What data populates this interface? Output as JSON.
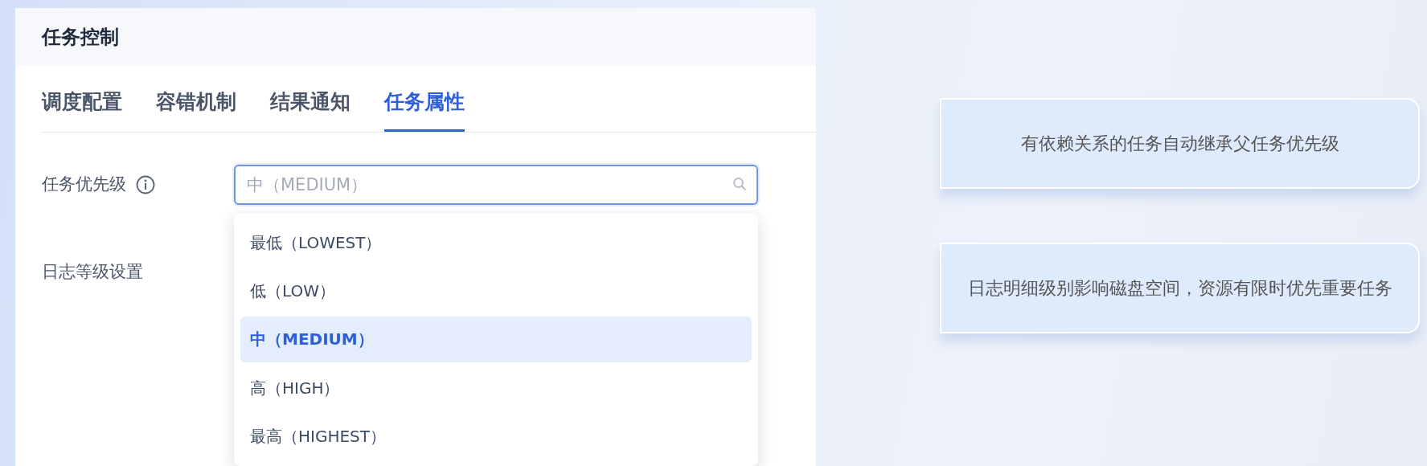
{
  "panel": {
    "title": "任务控制"
  },
  "tabs": [
    {
      "label": "调度配置",
      "selected": false
    },
    {
      "label": "容错机制",
      "selected": false
    },
    {
      "label": "结果通知",
      "selected": false
    },
    {
      "label": "任务属性",
      "selected": true
    }
  ],
  "fields": [
    {
      "label": "任务优先级",
      "info": true,
      "select": {
        "placeholder": "中（MEDIUM）",
        "open": true,
        "options": [
          {
            "label": "最低（LOWEST）",
            "selected": false
          },
          {
            "label": "低（LOW）",
            "selected": false
          },
          {
            "label": "中（MEDIUM）",
            "selected": true
          },
          {
            "label": "高（HIGH）",
            "selected": false
          },
          {
            "label": "最高（HIGHEST）",
            "selected": false
          }
        ]
      }
    },
    {
      "label": "日志等级设置"
    }
  ],
  "notes": [
    {
      "text": "有依赖关系的任务自动继承父任务优先级"
    },
    {
      "text": "日志明细级别影响磁盘空间，资源有限时优先重要任务"
    }
  ]
}
